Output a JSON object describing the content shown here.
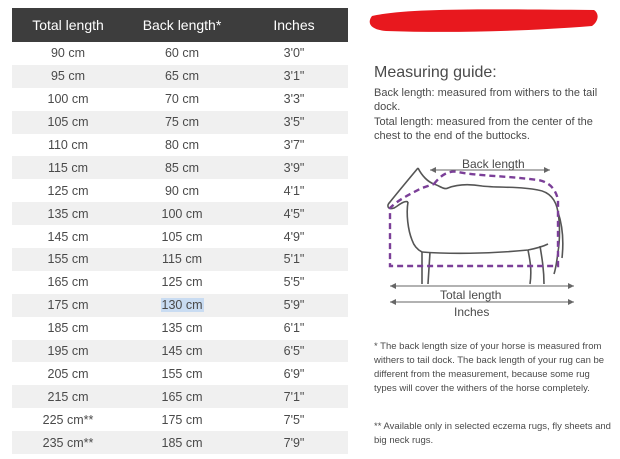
{
  "table": {
    "headers": [
      "Total length",
      "Back length*",
      "Inches"
    ],
    "rows": [
      [
        "90 cm",
        "60 cm",
        "3'0\""
      ],
      [
        "95 cm",
        "65 cm",
        "3'1\""
      ],
      [
        "100 cm",
        "70 cm",
        "3'3\""
      ],
      [
        "105 cm",
        "75 cm",
        "3'5\""
      ],
      [
        "110 cm",
        "80 cm",
        "3'7\""
      ],
      [
        "115 cm",
        "85 cm",
        "3'9\""
      ],
      [
        "125 cm",
        "90 cm",
        "4'1\""
      ],
      [
        "135 cm",
        "100 cm",
        "4'5\""
      ],
      [
        "145 cm",
        "105 cm",
        "4'9\""
      ],
      [
        "155 cm",
        "115 cm",
        "5'1\""
      ],
      [
        "165 cm",
        "125 cm",
        "5'5\""
      ],
      [
        "175 cm",
        "130 cm",
        "5'9\""
      ],
      [
        "185 cm",
        "135 cm",
        "6'1\""
      ],
      [
        "195 cm",
        "145 cm",
        "6'5\""
      ],
      [
        "205 cm",
        "155 cm",
        "6'9\""
      ],
      [
        "215 cm",
        "165 cm",
        "7'1\""
      ],
      [
        "225 cm**",
        "175 cm",
        "7'5\""
      ],
      [
        "235 cm**",
        "185 cm",
        "7'9\""
      ]
    ],
    "highlighted_row": 11,
    "highlighted_col": 1
  },
  "guide": {
    "title": "Measuring guide:",
    "back_length_text": "Back length: measured from withers to the tail dock.",
    "total_length_text": "Total length: measured from the center of the chest to the end of the buttocks.",
    "diagram": {
      "back_length_label": "Back length",
      "total_length_label": "Total length",
      "inches_label": "Inches"
    },
    "note1": "* The back length size of your horse is measured from withers to tail dock. The back length of your rug can be different from the measurement, because some rug types will cover the withers of the horse completely.",
    "note2": "** Available only in selected eczema rugs, fly sheets and big neck rugs."
  },
  "colors": {
    "header_bg": "#3d3d3d",
    "stripe": "#f0f0f0",
    "dashed_outline": "#7b3f98",
    "redaction": "#e8181e",
    "selection": "#c9dcf2"
  }
}
